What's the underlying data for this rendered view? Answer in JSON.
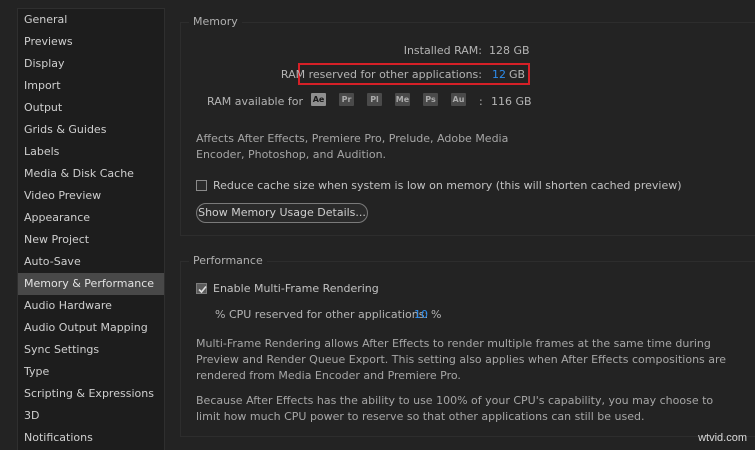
{
  "sidebar": {
    "items": [
      {
        "label": "General"
      },
      {
        "label": "Previews"
      },
      {
        "label": "Display"
      },
      {
        "label": "Import"
      },
      {
        "label": "Output"
      },
      {
        "label": "Grids & Guides"
      },
      {
        "label": "Labels"
      },
      {
        "label": "Media & Disk Cache"
      },
      {
        "label": "Video Preview"
      },
      {
        "label": "Appearance"
      },
      {
        "label": "New Project"
      },
      {
        "label": "Auto-Save"
      },
      {
        "label": "Memory & Performance",
        "selected": true
      },
      {
        "label": "Audio Hardware"
      },
      {
        "label": "Audio Output Mapping"
      },
      {
        "label": "Sync Settings"
      },
      {
        "label": "Type"
      },
      {
        "label": "Scripting & Expressions"
      },
      {
        "label": "3D"
      },
      {
        "label": "Notifications"
      }
    ]
  },
  "memory": {
    "title": "Memory",
    "installed_label": "Installed RAM:",
    "installed_value": "128 GB",
    "reserved_label": "RAM reserved for other applications:",
    "reserved_value": "12",
    "reserved_unit": "GB",
    "available_label": "RAM available for",
    "apps": [
      "Ae",
      "Pr",
      "Pl",
      "Me",
      "Ps",
      "Au"
    ],
    "available_colon": ":",
    "available_value": "116 GB",
    "affects_text": "Affects After Effects, Premiere Pro, Prelude, Adobe Media Encoder, Photoshop, and Audition.",
    "reduce_cache_label": "Reduce cache size when system is low on memory (this will shorten cached preview)",
    "reduce_cache_checked": false,
    "show_usage_button": "Show Memory Usage Details..."
  },
  "performance": {
    "title": "Performance",
    "mfr_label": "Enable Multi-Frame Rendering",
    "mfr_checked": true,
    "cpu_label": "% CPU reserved for other applications:",
    "cpu_value": "10",
    "cpu_unit": "%",
    "mfr_description": "Multi-Frame Rendering allows After Effects to render multiple frames at the same time during Preview and Render Queue Export. This setting also applies when After Effects compositions are rendered from Media Encoder and Premiere Pro.",
    "cpu_description": "Because After Effects has the ability to use 100% of your CPU's capability, you may choose to limit how much CPU power to reserve so that other applications can still be used."
  },
  "watermark": "wtvid.com",
  "colors": {
    "accent_blue": "#2d8ceb",
    "highlight_red": "#d52027",
    "selected_bg": "#484848"
  }
}
